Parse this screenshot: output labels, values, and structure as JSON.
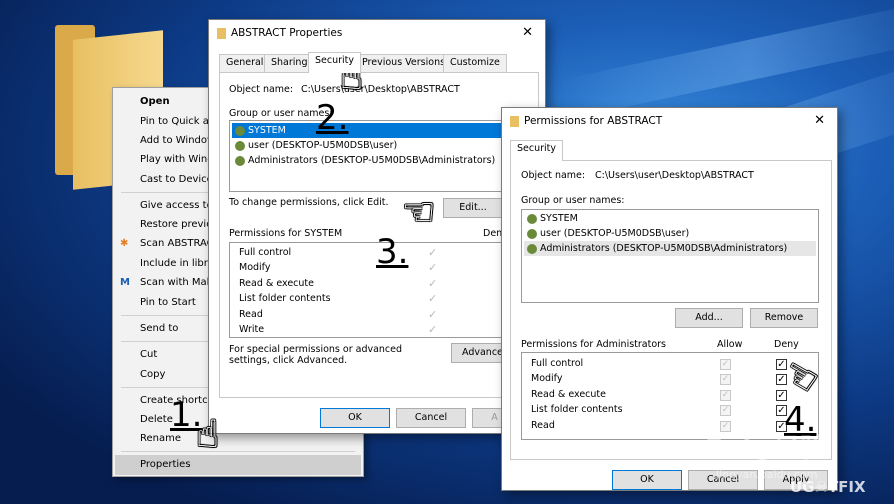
{
  "context_menu": {
    "items": [
      "Open",
      "Pin to Quick ac",
      "Add to Windov",
      "Play with Wind",
      "Cast to Device",
      "Give access to",
      "Restore previo",
      "Scan ABSTRAC",
      "Include in libra",
      "Scan with Malv",
      "Pin to Start",
      "Send to",
      "Cut",
      "Copy",
      "Create shortcut",
      "Delete",
      "Rename",
      "Properties"
    ]
  },
  "props": {
    "title": "ABSTRACT Properties",
    "tabs": [
      "General",
      "Sharing",
      "Security",
      "Previous Versions",
      "Customize"
    ],
    "object_label": "Object name:",
    "object_value": "C:\\Users\\user\\Desktop\\ABSTRACT",
    "group_label": "Group or user names:",
    "users": [
      "SYSTEM",
      "user (DESKTOP-U5M0DSB\\user)",
      "Administrators (DESKTOP-U5M0DSB\\Administrators)"
    ],
    "change_text": "To change permissions, click Edit.",
    "edit_label": "Edit...",
    "perm_label": "Permissions for SYSTEM",
    "deny_header": "Deny",
    "perms": [
      "Full control",
      "Modify",
      "Read & execute",
      "List folder contents",
      "Read",
      "Write"
    ],
    "special_text": "For special permissions or advanced settings, click Advanced.",
    "advanced_label": "Advance",
    "ok": "OK",
    "cancel": "Cancel",
    "apply": "A"
  },
  "perm_dialog": {
    "title": "Permissions for ABSTRACT",
    "tab": "Security",
    "object_label": "Object name:",
    "object_value": "C:\\Users\\user\\Desktop\\ABSTRACT",
    "group_label": "Group or user names:",
    "users": [
      "SYSTEM",
      "user (DESKTOP-U5M0DSB\\user)",
      "Administrators (DESKTOP-U5M0DSB\\Administrators)"
    ],
    "add_label": "Add...",
    "remove_label": "Remove",
    "perm_label": "Permissions for Administrators",
    "allow_header": "Allow",
    "deny_header": "Deny",
    "perms": [
      "Full control",
      "Modify",
      "Read & execute",
      "List folder contents",
      "Read"
    ],
    "ok": "OK",
    "cancel": "Cancel",
    "apply": "Apply"
  },
  "steps": [
    "1.",
    "2.",
    "3.",
    "4."
  ],
  "watermark": {
    "baidu": "Bai●经验",
    "url": "jingyan.baidu.com",
    "brand": "UG☠TFIX"
  }
}
